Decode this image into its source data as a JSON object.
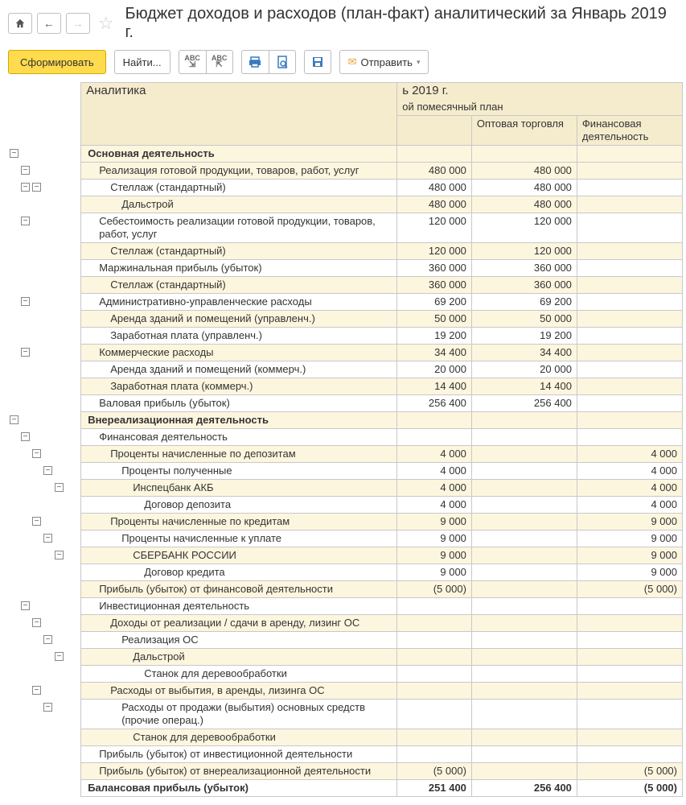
{
  "header": {
    "title": "Бюджет доходов и расходов (план-факт) аналитический  за Январь 2019 г."
  },
  "toolbar": {
    "form": "Сформировать",
    "find": "Найти...",
    "send": "Отправить"
  },
  "table_header": {
    "analytics": "Аналитика",
    "period": "ь 2019 г.",
    "plan": "ой помесячный план",
    "col2": "Оптовая торговля",
    "col3": "Финансовая деятельность"
  },
  "rows": [
    {
      "l": "Основная деятельность",
      "b": 1,
      "s": 1,
      "i": 0,
      "t": [
        0
      ],
      "v": [
        "",
        "",
        ""
      ]
    },
    {
      "l": "Реализация готовой продукции, товаров, работ, услуг",
      "i": 1,
      "s": 1,
      "t": [
        14
      ],
      "v": [
        "480 000",
        "480 000",
        ""
      ]
    },
    {
      "l": "Стеллаж (стандартный)",
      "i": 2,
      "s": 0,
      "t": [
        14,
        28
      ],
      "v": [
        "480 000",
        "480 000",
        ""
      ]
    },
    {
      "l": "Дальстрой",
      "i": 3,
      "s": 1,
      "t": [],
      "v": [
        "480 000",
        "480 000",
        ""
      ]
    },
    {
      "l": "Себестоимость реализации готовой продукции, товаров, работ, услуг",
      "i": 1,
      "s": 0,
      "h": 2,
      "t": [
        14
      ],
      "v": [
        "120 000",
        "120 000",
        ""
      ]
    },
    {
      "l": "Стеллаж (стандартный)",
      "i": 2,
      "s": 1,
      "t": [],
      "v": [
        "120 000",
        "120 000",
        ""
      ]
    },
    {
      "l": "Маржинальная прибыль (убыток)",
      "i": 1,
      "s": 0,
      "t": [],
      "v": [
        "360 000",
        "360 000",
        ""
      ]
    },
    {
      "l": "Стеллаж (стандартный)",
      "i": 2,
      "s": 1,
      "t": [],
      "v": [
        "360 000",
        "360 000",
        ""
      ]
    },
    {
      "l": "Административно-управленческие расходы",
      "i": 1,
      "s": 0,
      "t": [
        14
      ],
      "v": [
        "69 200",
        "69 200",
        ""
      ]
    },
    {
      "l": "Аренда зданий и помещений (управленч.)",
      "i": 2,
      "s": 1,
      "t": [],
      "v": [
        "50 000",
        "50 000",
        ""
      ]
    },
    {
      "l": "Заработная плата (управленч.)",
      "i": 2,
      "s": 0,
      "t": [],
      "v": [
        "19 200",
        "19 200",
        ""
      ]
    },
    {
      "l": "Коммерческие расходы",
      "i": 1,
      "s": 1,
      "t": [
        14
      ],
      "v": [
        "34 400",
        "34 400",
        ""
      ]
    },
    {
      "l": "Аренда зданий и помещений (коммерч.)",
      "i": 2,
      "s": 0,
      "t": [],
      "v": [
        "20 000",
        "20 000",
        ""
      ]
    },
    {
      "l": "Заработная плата (коммерч.)",
      "i": 2,
      "s": 1,
      "t": [],
      "v": [
        "14 400",
        "14 400",
        ""
      ]
    },
    {
      "l": "Валовая прибыль (убыток)",
      "i": 1,
      "s": 0,
      "t": [],
      "v": [
        "256 400",
        "256 400",
        ""
      ]
    },
    {
      "l": "Внереализационная деятельность",
      "b": 1,
      "s": 1,
      "i": 0,
      "t": [
        0
      ],
      "v": [
        "",
        "",
        ""
      ]
    },
    {
      "l": "Финансовая деятельность",
      "i": 1,
      "s": 0,
      "t": [
        14
      ],
      "v": [
        "",
        "",
        ""
      ]
    },
    {
      "l": "Проценты начисленные по депозитам",
      "i": 2,
      "s": 1,
      "t": [
        28
      ],
      "v": [
        "4 000",
        "",
        "4 000"
      ]
    },
    {
      "l": "Проценты полученные",
      "i": 3,
      "s": 0,
      "t": [
        42
      ],
      "v": [
        "4 000",
        "",
        "4 000"
      ]
    },
    {
      "l": "Инспецбанк АКБ",
      "i": 4,
      "s": 1,
      "t": [
        56
      ],
      "v": [
        "4 000",
        "",
        "4 000"
      ]
    },
    {
      "l": "Договор депозита",
      "i": 5,
      "s": 0,
      "t": [],
      "v": [
        "4 000",
        "",
        "4 000"
      ]
    },
    {
      "l": "Проценты начисленные по кредитам",
      "i": 2,
      "s": 1,
      "t": [
        28
      ],
      "v": [
        "9 000",
        "",
        "9 000"
      ]
    },
    {
      "l": "Проценты начисленные к уплате",
      "i": 3,
      "s": 0,
      "t": [
        42
      ],
      "v": [
        "9 000",
        "",
        "9 000"
      ]
    },
    {
      "l": "СБЕРБАНК РОССИИ",
      "i": 4,
      "s": 1,
      "t": [
        56
      ],
      "v": [
        "9 000",
        "",
        "9 000"
      ]
    },
    {
      "l": "Договор кредита",
      "i": 5,
      "s": 0,
      "t": [],
      "v": [
        "9 000",
        "",
        "9 000"
      ]
    },
    {
      "l": "Прибыль (убыток) от финансовой деятельности",
      "i": 1,
      "s": 1,
      "t": [],
      "v": [
        "(5 000)",
        "",
        "(5 000)"
      ]
    },
    {
      "l": "Инвестиционная деятельность",
      "i": 1,
      "s": 0,
      "t": [
        14
      ],
      "v": [
        "",
        "",
        ""
      ]
    },
    {
      "l": "Доходы от реализации / сдачи в аренду, лизинг ОС",
      "i": 2,
      "s": 1,
      "t": [
        28
      ],
      "v": [
        "",
        "",
        ""
      ]
    },
    {
      "l": "Реализация ОС",
      "i": 3,
      "s": 0,
      "t": [
        42
      ],
      "v": [
        "",
        "",
        ""
      ]
    },
    {
      "l": "Дальстрой",
      "i": 4,
      "s": 1,
      "t": [
        56
      ],
      "v": [
        "",
        "",
        ""
      ]
    },
    {
      "l": "Станок для деревообработки",
      "i": 5,
      "s": 0,
      "t": [],
      "v": [
        "",
        "",
        ""
      ]
    },
    {
      "l": "Расходы от выбытия, в аренды, лизинга ОС",
      "i": 2,
      "s": 1,
      "t": [
        28
      ],
      "v": [
        "",
        "",
        ""
      ]
    },
    {
      "l": "Расходы от продажи (выбытия) основных средств (прочие операц.)",
      "i": 3,
      "h": 2,
      "s": 0,
      "t": [
        42
      ],
      "v": [
        "",
        "",
        ""
      ]
    },
    {
      "l": "Станок для деревообработки",
      "i": 4,
      "s": 1,
      "t": [],
      "v": [
        "",
        "",
        ""
      ]
    },
    {
      "l": "Прибыль (убыток) от инвестиционной деятельности",
      "i": 1,
      "s": 0,
      "t": [],
      "v": [
        "",
        "",
        ""
      ]
    },
    {
      "l": "Прибыль (убыток) от внереализационной деятельности",
      "i": 1,
      "s": 1,
      "t": [],
      "v": [
        "(5 000)",
        "",
        "(5 000)"
      ]
    },
    {
      "l": "Балансовая прибыль (убыток)",
      "b": 1,
      "i": 0,
      "s": 0,
      "t": [],
      "v": [
        "251 400",
        "256 400",
        "(5 000)"
      ]
    }
  ]
}
